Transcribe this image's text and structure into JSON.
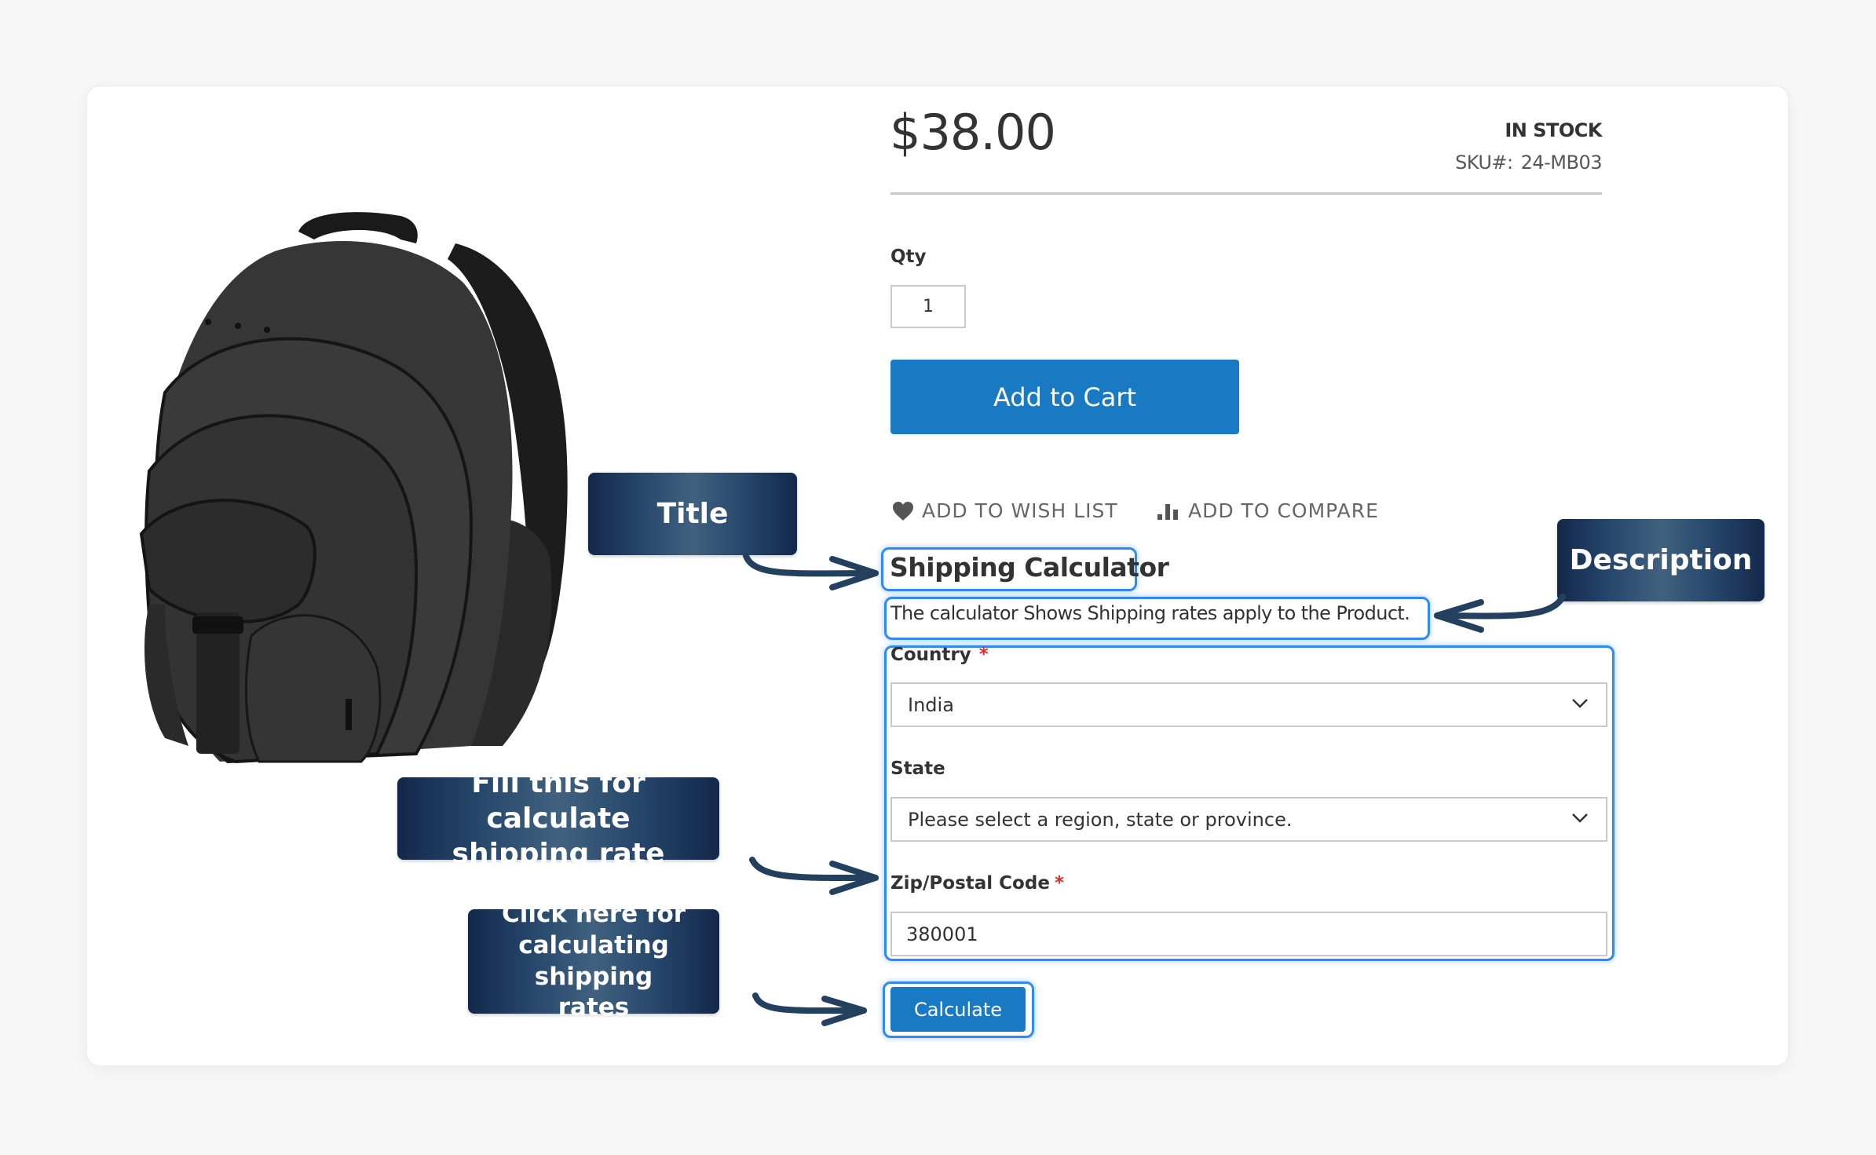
{
  "product": {
    "image_alt": "Black backpack",
    "price": "$38.00",
    "stock_status": "IN STOCK",
    "sku_label": "SKU#:",
    "sku_value": "24-MB03",
    "qty_label": "Qty",
    "qty_value": "1",
    "add_to_cart_label": "Add to Cart",
    "wish_list_label": "ADD TO WISH LIST",
    "compare_label": "ADD TO COMPARE"
  },
  "shipping_calculator": {
    "title": "Shipping Calculator",
    "description": "The calculator Shows Shipping rates apply to the Product.",
    "country_label": "Country",
    "country_value": "India",
    "state_label": "State",
    "state_value": "Please select a region, state or province.",
    "zip_label": "Zip/Postal Code",
    "zip_value": "380001",
    "required_marker": "*",
    "calculate_label": "Calculate"
  },
  "annotations": {
    "title": "Title",
    "description": "Description",
    "fill": "Fill this for calculate shipping rate",
    "click": "Click here for calculating shipping rates"
  },
  "colors": {
    "accent_blue": "#1979c3",
    "highlight_blue": "#2f8af5",
    "callout_navy": "#13284a",
    "required_red": "#e02b27"
  }
}
